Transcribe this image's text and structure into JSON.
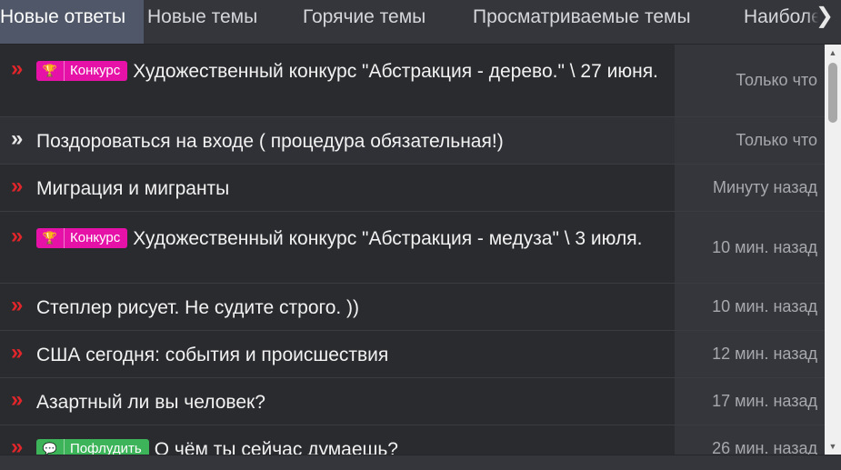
{
  "tabs": [
    {
      "label": "Новые ответы"
    },
    {
      "label": "Новые темы"
    },
    {
      "label": "Горячие темы"
    },
    {
      "label": "Просматриваемые темы"
    },
    {
      "label": "Наиболее"
    }
  ],
  "tab_scroll_icon": "chevron-right-icon",
  "colors": {
    "unread_arrow": "#e0262b",
    "contest_badge": "#e612a8",
    "flood_badge": "#3db35a",
    "active_tab": "#4f5768"
  },
  "threads": [
    {
      "arrow": "»",
      "badge": {
        "icon": "trophy-icon",
        "glyph": "🏆",
        "label": "Конкурс"
      },
      "title": "Художественный конкурс \"Абстракция - дерево.\" \\ 27 июня.",
      "time": "Только что",
      "read": false
    },
    {
      "arrow": "»",
      "title": "Поздороваться на входе ( процедура обязательная!)",
      "time": "Только что",
      "read": true
    },
    {
      "arrow": "»",
      "title": "Миграция и мигранты",
      "time": "Минуту назад",
      "read": false
    },
    {
      "arrow": "»",
      "badge": {
        "icon": "trophy-icon",
        "glyph": "🏆",
        "label": "Конкурс"
      },
      "title": "Художественный конкурс \"Абстракция - медуза\" \\ 3 июля.",
      "time": "10 мин. назад",
      "read": false
    },
    {
      "arrow": "»",
      "title": "Степлер рисует. Не судите строго. ))",
      "time": "10 мин. назад",
      "read": false
    },
    {
      "arrow": "»",
      "title": "США сегодня: события и происшествия",
      "time": "12 мин. назад",
      "read": false
    },
    {
      "arrow": "»",
      "title": "Азартный ли вы человек?",
      "time": "17 мин. назад",
      "read": false
    },
    {
      "arrow": "»",
      "badge": {
        "icon": "chat-bubbles-icon",
        "glyph": "💬",
        "label": "Пофлудить"
      },
      "title": "О чём ты сейчас думаешь?",
      "time": "26 мин. назад",
      "read": false
    }
  ],
  "scrollbar": {
    "up": "▲",
    "down": "▼"
  }
}
